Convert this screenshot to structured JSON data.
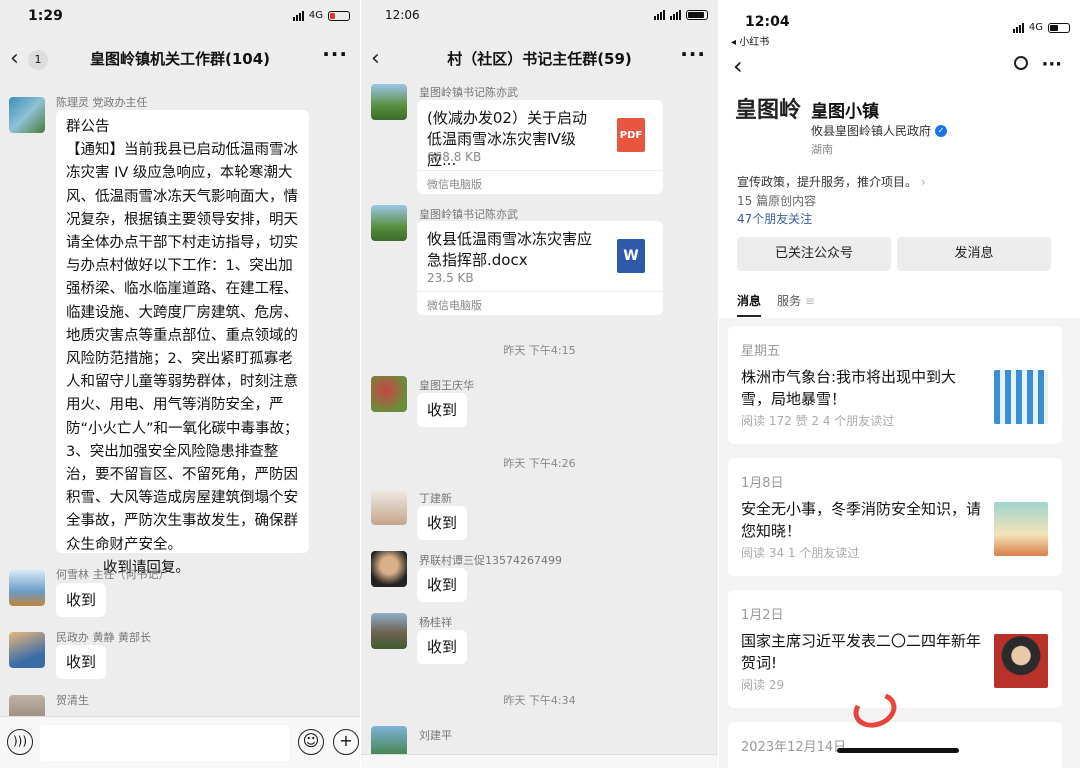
{
  "panel1": {
    "status": {
      "time": "1:29",
      "network": "4G"
    },
    "nav": {
      "back_count": "1",
      "title": "皇图岭镇机关工作群(104)",
      "more": "···"
    },
    "messages": [
      {
        "sender": "陈理灵 党政办主任",
        "text": "群公告\n【通知】当前我县已启动低温雨雪冰冻灾害 IV 级应急响应，本轮寒潮大风、低温雨雪冰冻天气影响面大，情况复杂，根据镇主要领导安排，明天请全体办点干部下村走访指导，切实与办点村做好以下工作：1、突出加强桥梁、临水临崖道路、在建工程、临建设施、大跨度厂房建筑、危房、地质灾害点等重点部位、重点领域的风险防范措施；2、突出紧盯孤寡老人和留守儿童等弱势群体，时刻注意用火、用电、用气等消防安全，严防“小火亡人”和一氧化碳中毒事故；3、突出加强安全风险隐患排查整治，要不留盲区、不留死角，严防因积雪、大风等造成房屋建筑倒塌个安全事故，严防次生事故发生，确保群众生命财产安全。\n        收到请回复。"
      },
      {
        "sender": "何雪林 主任（何书记）",
        "text": "收到"
      },
      {
        "sender": "民政办 黄静 黄部长",
        "text": "收到"
      },
      {
        "sender": "贺清生",
        "text": ""
      }
    ]
  },
  "panel2": {
    "status": {
      "time": "12:06"
    },
    "nav": {
      "title": "村（社区）书记主任群(59)",
      "more": "···"
    },
    "files": [
      {
        "sender": "皇图岭镇书记陈亦武",
        "title": "(攸减办发02）关于启动低温雨雪冰冻灾害Ⅳ级应...",
        "size": "668.8 KB",
        "type": "PDF",
        "source": "微信电脑版"
      },
      {
        "sender": "皇图岭镇书记陈亦武",
        "title": "攸县低温雨雪冰冻灾害应急指挥部.docx",
        "size": "23.5 KB",
        "type": "W",
        "source": "微信电脑版"
      }
    ],
    "time1": "昨天 下午4:15",
    "msg1": {
      "sender": "皇图王庆华",
      "text": "收到"
    },
    "time2": "昨天 下午4:26",
    "msg2": {
      "sender": "丁建新",
      "text": "收到"
    },
    "msg3": {
      "sender": "界联村谭三促13574267499",
      "text": "收到"
    },
    "msg4": {
      "sender": "杨桂祥",
      "text": "收到"
    },
    "time3": "昨天 下午4:34",
    "msg5": {
      "sender": "刘建平",
      "text": ""
    }
  },
  "panel3": {
    "status": {
      "time": "12:04",
      "back_app": "◂ 小红书",
      "network": "4G"
    },
    "account": {
      "logo_text": "皇图岭",
      "name": "皇图小镇",
      "org": "攸县皇图岭镇人民政府",
      "region": "湖南",
      "intro": "宣传政策，提升服务，推介项目。",
      "articles": "15 篇原创内容",
      "friends": "47个朋友关注"
    },
    "buttons": {
      "followed": "已关注公众号",
      "message": "发消息"
    },
    "tabs": {
      "messages": "消息",
      "service": "服务"
    },
    "articles": [
      {
        "day": "星期五",
        "title": "株洲市气象台:我市将出现中到大雪，局地暴雪！",
        "meta": "阅读 172  赞 2  4 个朋友读过"
      },
      {
        "day": "1月8日",
        "title": "安全无小事，冬季消防安全知识，请您知晓！",
        "meta": "阅读 34  1 个朋友读过"
      },
      {
        "day": "1月2日",
        "title": "国家主席习近平发表二〇二四年新年贺词!",
        "meta": "阅读 29"
      },
      {
        "day": "2023年12月14日",
        "title": "",
        "meta": ""
      }
    ],
    "colors": {
      "accent": "#576b95",
      "verified": "#1a73e8",
      "link": "#3d5a99"
    }
  }
}
